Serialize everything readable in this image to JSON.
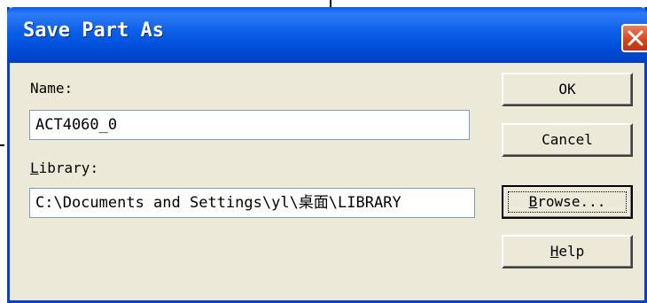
{
  "window": {
    "title": "Save Part As",
    "close_icon": "close-icon"
  },
  "form": {
    "name_label": "Name:",
    "name_value": "ACT4060_0",
    "library_label_first": "L",
    "library_label_rest": "ibrary:",
    "library_value": "C:\\Documents and Settings\\yl\\桌面\\LIBRARY"
  },
  "buttons": {
    "ok": "OK",
    "cancel": "Cancel",
    "browse_first": "B",
    "browse_rest": "rowse...",
    "help_first": "H",
    "help_rest": "elp"
  },
  "colors": {
    "title_bar": "#0a5ee8",
    "dialog_bg": "#ece9d8",
    "close_red": "#d4431b"
  }
}
